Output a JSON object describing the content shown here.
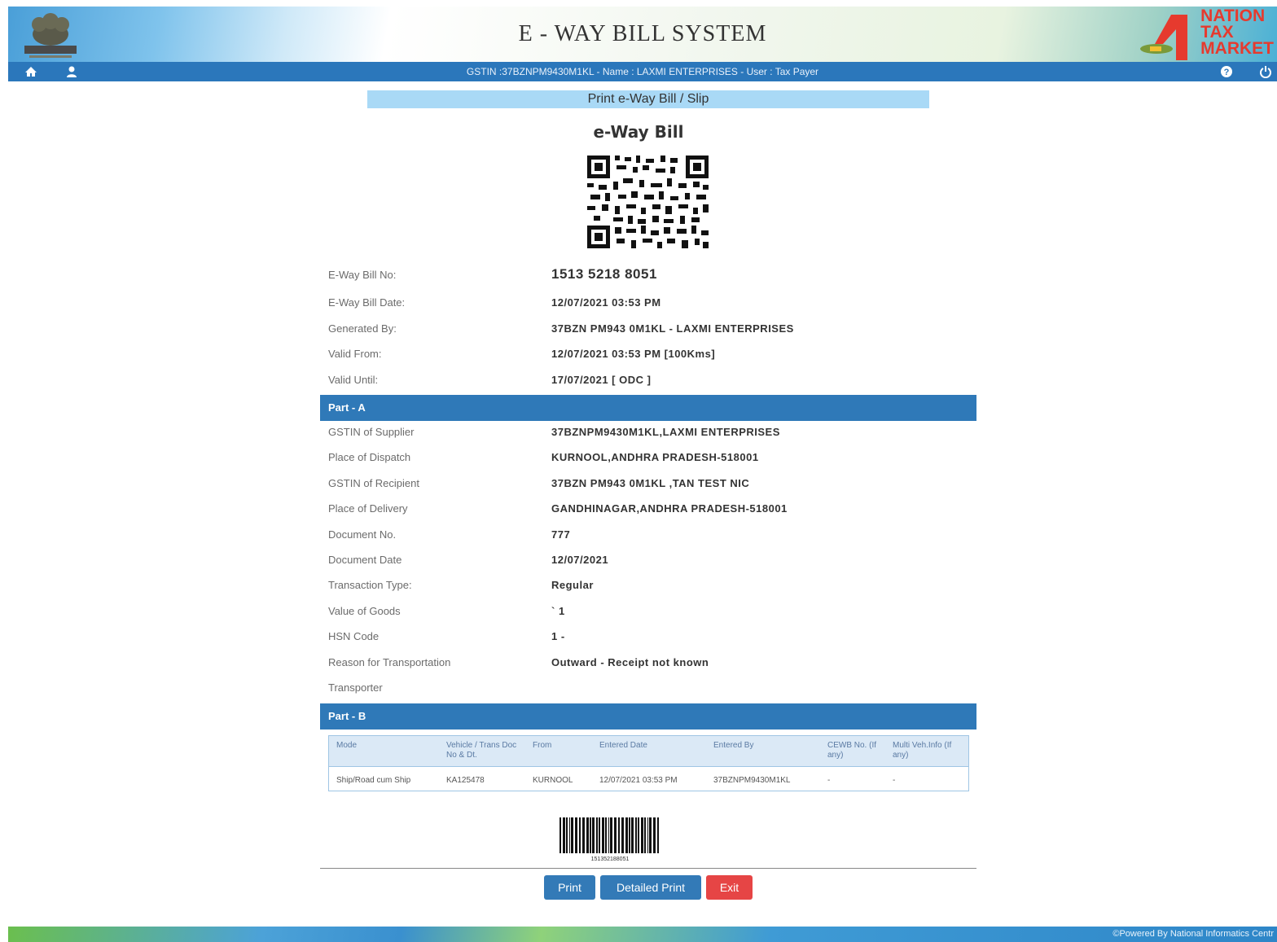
{
  "header": {
    "title": "E - WAY BILL SYSTEM",
    "brand_line1": "NATION",
    "brand_line2": "TAX",
    "brand_line3": "MARKET"
  },
  "navbar": {
    "info": "GSTIN :37BZNPM9430M1KL - Name : LAXMI ENTERPRISES - User : Tax Payer"
  },
  "page": {
    "subtitle": "Print e-Way Bill / Slip",
    "bill_title": "e-Way Bill"
  },
  "summary": [
    {
      "label": "E-Way Bill No:",
      "value": "1513 5218 8051"
    },
    {
      "label": "E-Way Bill Date:",
      "value": "12/07/2021 03:53 PM"
    },
    {
      "label": "Generated By:",
      "value": "37BZN PM943 0M1KL - LAXMI ENTERPRISES"
    },
    {
      "label": "Valid From:",
      "value": "12/07/2021 03:53 PM [100Kms]"
    },
    {
      "label": "Valid Until:",
      "value": "17/07/2021 [ ODC ]"
    }
  ],
  "part_a": {
    "title": "Part - A",
    "rows": [
      {
        "label": "GSTIN of Supplier",
        "value": "37BZNPM9430M1KL,LAXMI ENTERPRISES"
      },
      {
        "label": "Place of Dispatch",
        "value": "KURNOOL,ANDHRA PRADESH-518001"
      },
      {
        "label": "GSTIN of Recipient",
        "value": "37BZN PM943 0M1KL ,TAN TEST NIC"
      },
      {
        "label": "Place of Delivery",
        "value": "GANDHINAGAR,ANDHRA PRADESH-518001"
      },
      {
        "label": "Document No.",
        "value": "777"
      },
      {
        "label": "Document Date",
        "value": "12/07/2021"
      },
      {
        "label": "Transaction Type:",
        "value": "Regular"
      },
      {
        "label": "Value of Goods",
        "value": "` 1"
      },
      {
        "label": "HSN Code",
        "value": "1 -"
      },
      {
        "label": "Reason for Transportation",
        "value": "Outward - Receipt not known"
      },
      {
        "label": "Transporter",
        "value": ""
      }
    ]
  },
  "part_b": {
    "title": "Part - B",
    "headers": [
      "Mode",
      "Vehicle / Trans Doc No & Dt.",
      "From",
      "Entered Date",
      "Entered By",
      "CEWB No. (If any)",
      "Multi Veh.Info (If any)"
    ],
    "row": [
      "Ship/Road cum Ship",
      "KA125478",
      "KURNOOL",
      "12/07/2021 03:53 PM",
      "37BZNPM9430M1KL",
      "-",
      "-"
    ]
  },
  "barcode": {
    "number": "151352188051"
  },
  "buttons": {
    "print": "Print",
    "detailed_print": "Detailed Print",
    "exit": "Exit"
  },
  "footer": {
    "credit": "©Powered By National Informatics Centr"
  },
  "colors": {
    "nav": "#2b77bb",
    "section": "#2f79b8",
    "subtitle_bg": "#a9d9f6",
    "exit": "#e64545",
    "primary": "#337ab7"
  }
}
